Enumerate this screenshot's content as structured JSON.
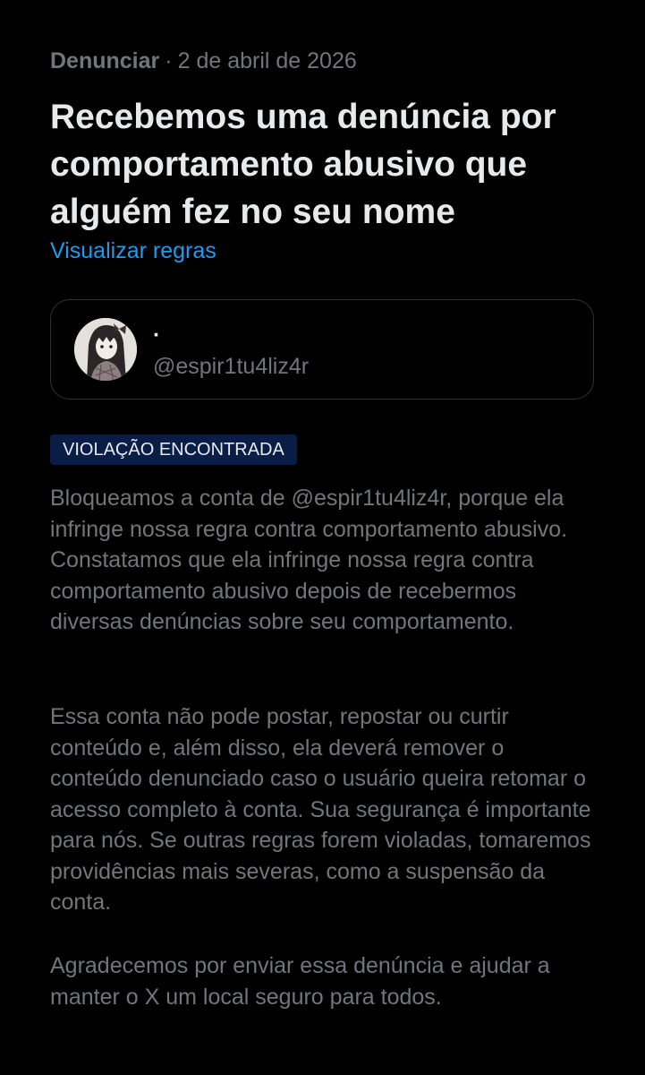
{
  "header": {
    "type": "Denunciar",
    "separator": "·",
    "date": "2 de abril de 2026"
  },
  "headline": "Recebemos uma denúncia por comportamento abusivo que alguém fez no seu nome",
  "rules_link": "Visualizar regras",
  "account": {
    "display_name": "·",
    "handle": "@espir1tu4liz4r",
    "avatar_icon": "avatar-illustration"
  },
  "badge": "VIOLAÇÃO ENCONTRADA",
  "paragraphs": [
    "Bloqueamos a conta de @espir1tu4liz4r, porque ela infringe nossa regra contra comportamento abusivo. Constatamos que ela infringe nossa regra contra comportamento abusivo depois de recebermos diversas denúncias sobre seu comportamento.",
    "Essa conta não pode postar, repostar ou curtir conteúdo e, além disso, ela deverá remover o conteúdo denunciado caso o usuário queira retomar o acesso completo à conta. Sua segurança é importante para nós. Se outras regras forem violadas, tomaremos providências mais severas, como a suspensão da conta.",
    "Agradecemos por enviar essa denúncia e ajudar a manter o X um local seguro para todos."
  ],
  "colors": {
    "background": "#000000",
    "primary_text": "#e7e9ea",
    "secondary_text": "#71767b",
    "link": "#1d9bf0",
    "badge_bg": "#0a1d47",
    "card_border": "#2f3336"
  }
}
